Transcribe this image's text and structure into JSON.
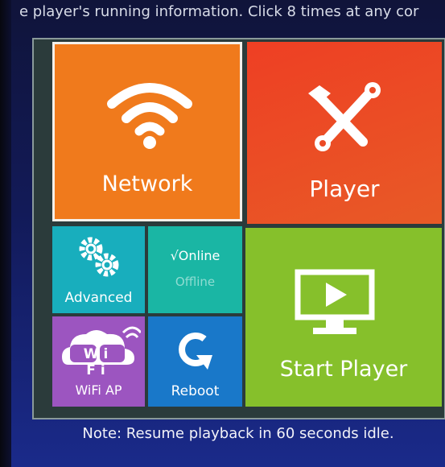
{
  "marquee": {
    "text": "e player's running information. Click 8 times at any cor"
  },
  "tiles": {
    "network": {
      "label": "Network",
      "icon": "wifi-icon",
      "color": "#f07a1c"
    },
    "player": {
      "label": "Player",
      "icon": "tools-icon",
      "color": "#ee3f24"
    },
    "advanced": {
      "label": "Advanced",
      "icon": "gears-icon",
      "color": "#18aebd"
    },
    "status": {
      "online": "√Online",
      "offline": "Offline",
      "color": "#1ab6a4"
    },
    "wifi_ap": {
      "label": "WiFi AP",
      "icon_text": "Wi Fi",
      "icon": "wifi-cloud-icon",
      "color": "#9c55c0"
    },
    "reboot": {
      "label": "Reboot",
      "icon": "reboot-icon",
      "color": "#1978c9"
    },
    "start_player": {
      "label": "Start Player",
      "icon": "monitor-play-icon",
      "color": "#86c02b"
    }
  },
  "note": "Note: Resume playback in 60 seconds idle."
}
